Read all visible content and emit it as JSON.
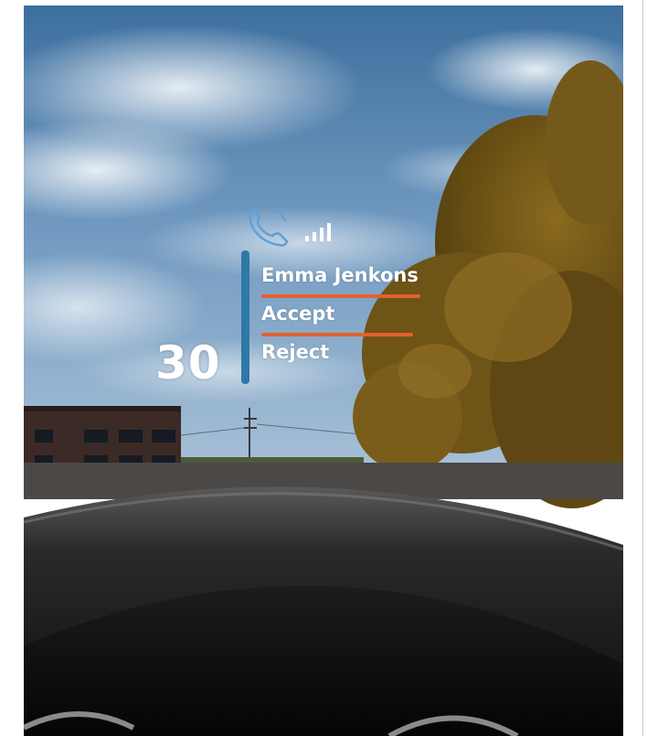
{
  "hud": {
    "speed": "30",
    "caller_name": "Emma Jenkons",
    "accept_label": "Accept",
    "reject_label": "Reject",
    "icons": [
      "phone-icon",
      "signal-icon"
    ]
  },
  "colors": {
    "accent_blue": "#2f78a8",
    "accent_orange": "#e2612d",
    "hud_text": "#ffffff"
  }
}
